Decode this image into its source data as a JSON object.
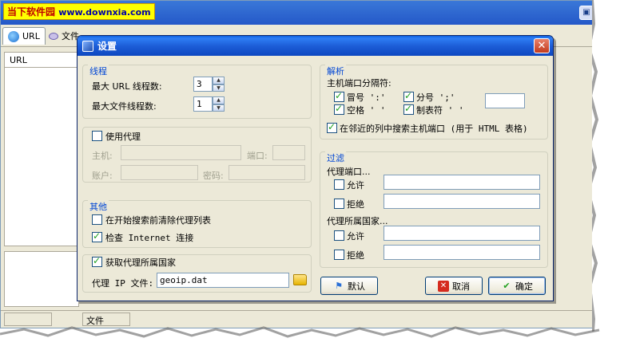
{
  "background": {
    "logo_text": "当下软件园",
    "logo_url": "www.downxia.com",
    "tab_url": "URL",
    "tab_files": "文件",
    "list_header": "URL",
    "status_files": "文件"
  },
  "dialog": {
    "title": "设置",
    "close_glyph": "✕",
    "threads": {
      "title": "线程",
      "max_url_label": "最大 URL 线程数:",
      "max_url_value": "3",
      "max_file_label": "最大文件线程数:",
      "max_file_value": "1"
    },
    "proxy": {
      "use_proxy_label": "使用代理",
      "host_label": "主机:",
      "port_label": "端口:",
      "account_label": "账户:",
      "password_label": "密码:"
    },
    "other": {
      "title": "其他",
      "clear_list_label": "在开始搜索前清除代理列表",
      "check_internet_label": "检查 Internet 连接"
    },
    "geo": {
      "get_country_label": "获取代理所属国家",
      "ip_file_label": "代理 IP 文件:",
      "ip_file_value": "geoip.dat"
    },
    "parse": {
      "title": "解析",
      "separator_label": "主机端口分隔符:",
      "colon_label": "冒号 ':'",
      "semicolon_label": "分号 ';'",
      "space_label": "空格 ' '",
      "tab_label": "制表符 '    '",
      "search_adjacent_label": "在邻近的列中搜索主机端口 (用于 HTML 表格)"
    },
    "filter": {
      "title": "过滤",
      "proxy_port_label": "代理端口...",
      "allow_label": "允许",
      "deny_label": "拒绝",
      "country_label": "代理所属国家...",
      "allow_label2": "允许",
      "deny_label2": "拒绝"
    },
    "buttons": {
      "default_label": "默认",
      "cancel_label": "取消",
      "ok_label": "确定"
    }
  }
}
